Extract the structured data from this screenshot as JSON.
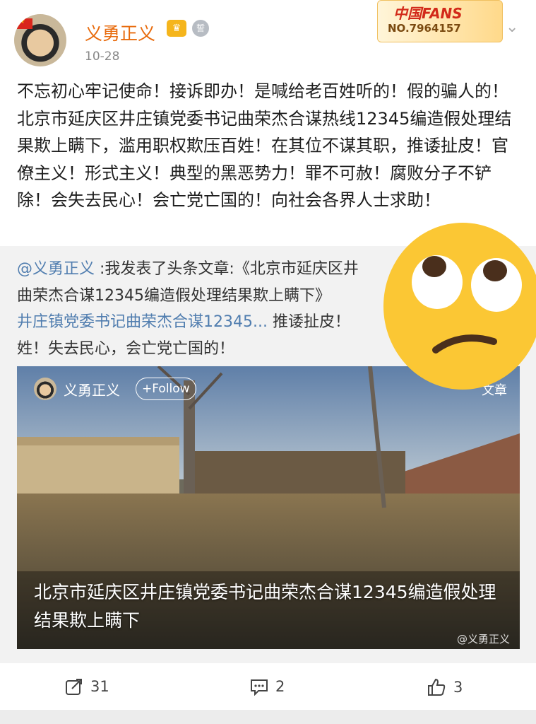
{
  "header": {
    "username": "义勇正义",
    "vip_badge": "♛",
    "level_badge": "誓",
    "date": "10-28",
    "fans_badge": {
      "title": "中国FANS",
      "number": "NO.7964157"
    }
  },
  "post": {
    "text": "不忘初心牢记使命！接诉即办！是喊给老百姓听的！假的骗人的！北京市延庆区井庄镇党委书记曲荣杰合谋热线12345编造假处理结果欺上瞒下，滥用职权欺压百姓！在其位不谋其职，推诿扯皮！官僚主义！形式主义！典型的黑恶势力！罪不可赦！腐败分子不铲除！会失去民心！会亡党亡国的！向社会各界人士求助！"
  },
  "repost": {
    "mention": "@义勇正义",
    "text_a": " :我发表了头条文章:《北京市延庆区井",
    "text_b": "曲荣杰合谋12345编造假处理结果欺上瞒下》 ",
    "link_text": "井庄镇党委书记曲荣杰合谋12345...",
    "text_c": " 推诿扯皮！",
    "text_d": "姓！失去民心，会亡党亡国的！",
    "card": {
      "author": "义勇正义",
      "follow_label": "+Follow",
      "tag": "文章",
      "title": "北京市延庆区井庄镇党委书记曲荣杰合谋12345编造假处理结果欺上瞒下",
      "watermark": "@义勇正义"
    }
  },
  "actions": {
    "repost_count": "31",
    "comment_count": "2",
    "like_count": "3"
  },
  "colors": {
    "username": "#e86b0d",
    "link": "#507daf",
    "emoji_face": "#fbc734"
  }
}
